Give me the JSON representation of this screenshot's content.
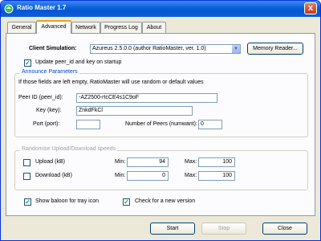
{
  "window": {
    "title": "Ratio Master 1.7",
    "close_label": "x"
  },
  "tabs": [
    "General",
    "Advanced",
    "Network",
    "Progress Log",
    "About"
  ],
  "client": {
    "label": "Client Simulation:",
    "value": "Azureus 2.5.0.0 (author RatioMaster, ver. 1.0)",
    "memory_button": "Memory Reader..."
  },
  "update_peer": {
    "label": "Update peer_id and key on startup",
    "checked": true
  },
  "announce": {
    "title": "Announce Parameters",
    "note": "If those fields are left empty, RatioMaster will use random or default values",
    "peer_id_label": "Peer ID (peer_id):",
    "peer_id_value": "-AZ2500-rtcCE4s1C9oF",
    "key_label": "Key (key):",
    "key_value": "ZnkdFkCl",
    "port_label": "Port (port):",
    "port_value": "",
    "numwant_label": "Number of Peers (numwant):",
    "numwant_value": "0"
  },
  "speeds": {
    "title": "Randomise Upload/Download speeds",
    "upload_label": "Upload  (kB)",
    "download_label": "Download (kB)",
    "min_label": "Min:",
    "max_label": "Max:",
    "upload_min": "94",
    "upload_max": "100",
    "download_min": "0",
    "download_max": "100"
  },
  "options": {
    "balloon_label": "Show baloon for tray icon",
    "check_version_label": "Check for a new version"
  },
  "buttons": {
    "start": "Start",
    "stop": "Stop",
    "close": "Close"
  },
  "colors": {
    "title_bar": "#0a5fd8",
    "group_title": "#0046d5",
    "check_mark": "#21a121"
  }
}
